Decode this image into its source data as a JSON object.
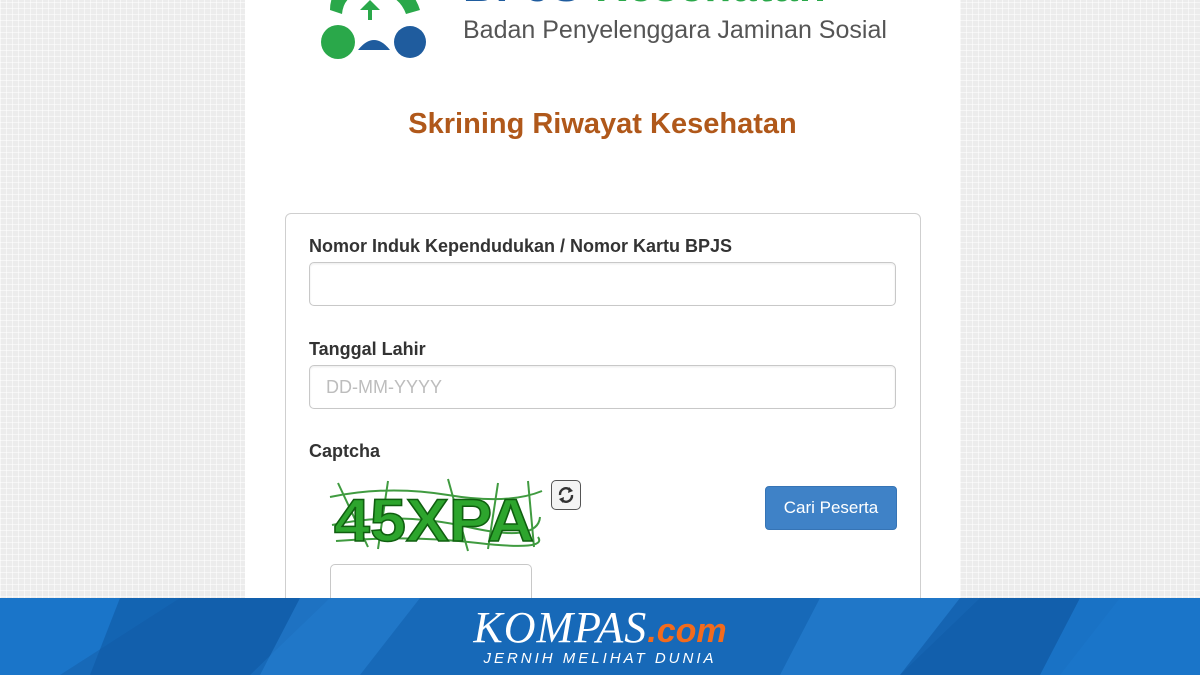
{
  "brand": {
    "name_part1": "BPJS ",
    "name_part2": "Kesehatan",
    "subtitle": "Badan Penyelenggara Jaminan Sosial"
  },
  "page_title": "Skrining Riwayat Kesehatan",
  "form": {
    "nik_label": "Nomor Induk Kependudukan / Nomor Kartu BPJS",
    "nik_value": "",
    "dob_label": "Tanggal Lahir",
    "dob_placeholder": "DD-MM-YYYY",
    "captcha_label": "Captcha",
    "captcha_text": "45XPA",
    "search_button": "Cari Peserta"
  },
  "footer": {
    "logo_main": "KOMPAS",
    "logo_suffix": ".com",
    "tagline": "JERNIH MELIHAT DUNIA"
  },
  "colors": {
    "title": "#b0581a",
    "button": "#3f82c7",
    "footer": "#1769b8",
    "brand_blue": "#1f5c9e",
    "brand_green": "#2aa84a"
  },
  "icons": [
    "bpjs-logo-icon",
    "refresh-icon"
  ]
}
